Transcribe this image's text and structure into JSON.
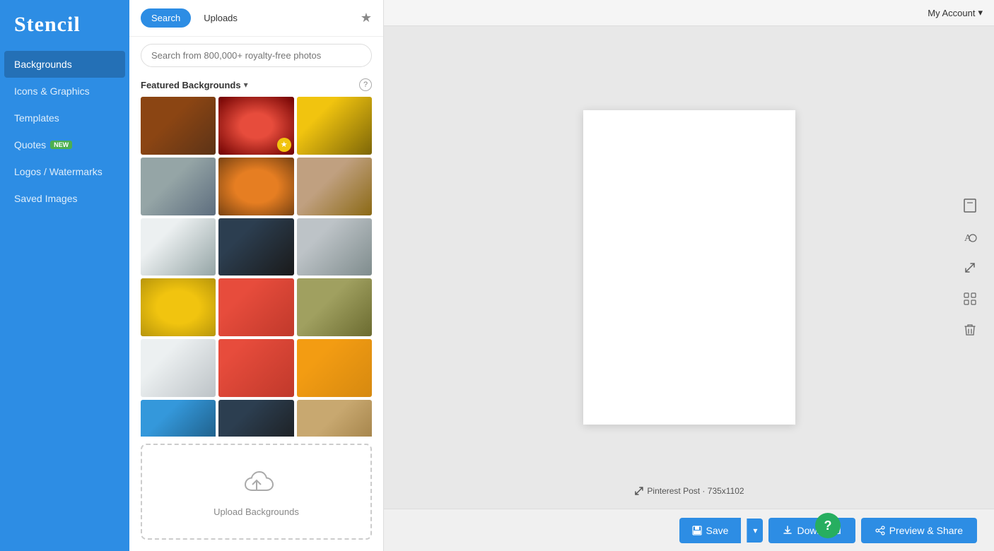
{
  "app": {
    "name": "Stencil"
  },
  "sidebar": {
    "items": [
      {
        "id": "backgrounds",
        "label": "Backgrounds",
        "active": true,
        "badge": null
      },
      {
        "id": "icons-graphics",
        "label": "Icons & Graphics",
        "active": false,
        "badge": null
      },
      {
        "id": "templates",
        "label": "Templates",
        "active": false,
        "badge": null
      },
      {
        "id": "quotes",
        "label": "Quotes",
        "active": false,
        "badge": "NEW"
      },
      {
        "id": "logos-watermarks",
        "label": "Logos / Watermarks",
        "active": false,
        "badge": null
      },
      {
        "id": "saved-images",
        "label": "Saved Images",
        "active": false,
        "badge": null
      }
    ]
  },
  "panel": {
    "tabs": [
      {
        "id": "search",
        "label": "Search",
        "active": true
      },
      {
        "id": "uploads",
        "label": "Uploads",
        "active": false
      }
    ],
    "search_placeholder": "Search from 800,000+ royalty-free photos",
    "featured_label": "Featured Backgrounds",
    "upload_label": "Upload Backgrounds"
  },
  "header": {
    "account_label": "My Account"
  },
  "canvas": {
    "size_label": "Pinterest Post · 735x1102"
  },
  "toolbar": {
    "save_label": "Save",
    "download_label": "Download",
    "preview_label": "Preview & Share"
  }
}
